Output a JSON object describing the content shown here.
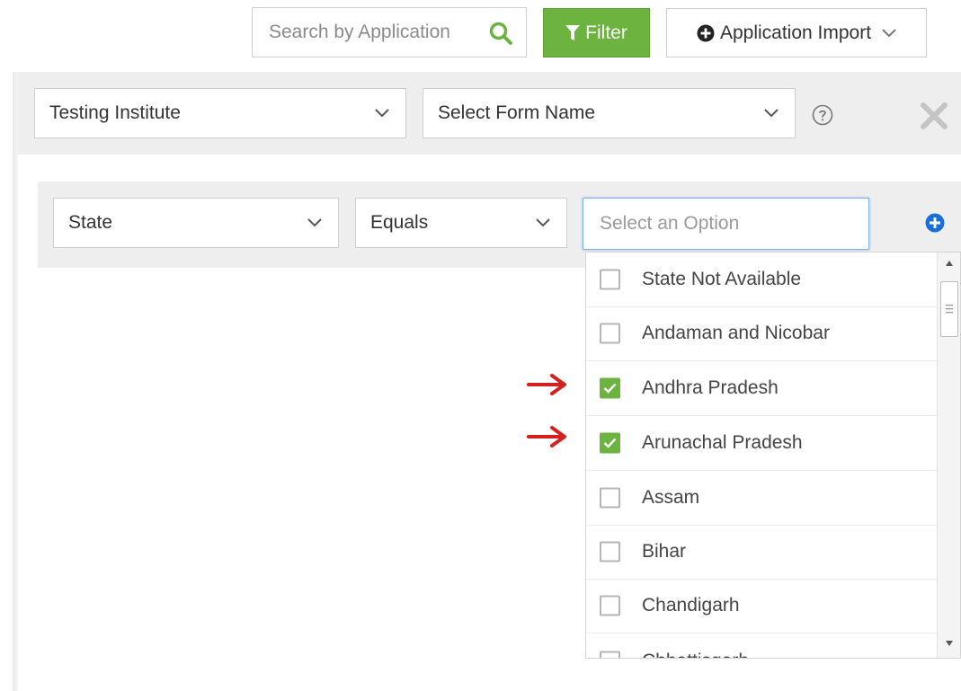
{
  "toolbar": {
    "search_placeholder": "Search by Application",
    "filter_label": "Filter",
    "import_label": "Application Import"
  },
  "form_filters": {
    "institute_value": "Testing Institute",
    "form_name_placeholder": "Select Form Name"
  },
  "condition": {
    "field_value": "State",
    "operator_value": "Equals",
    "option_placeholder": "Select an Option"
  },
  "options": [
    {
      "label": "State Not Available",
      "checked": false
    },
    {
      "label": "Andaman and Nicobar",
      "checked": false
    },
    {
      "label": "Andhra Pradesh",
      "checked": true
    },
    {
      "label": "Arunachal Pradesh",
      "checked": true
    },
    {
      "label": "Assam",
      "checked": false
    },
    {
      "label": "Bihar",
      "checked": false
    },
    {
      "label": "Chandigarh",
      "checked": false
    },
    {
      "label": "Chhattisgarh",
      "checked": false
    }
  ],
  "colors": {
    "accent_green": "#6db33f",
    "focus_blue": "#7fb0e6",
    "add_blue": "#1a6fd6",
    "annotation_red": "#d62020"
  },
  "icons": {
    "search": "magnifier-icon",
    "filter": "funnel-icon",
    "import": "plus-circle-icon",
    "help": "question-circle-icon",
    "close": "x-icon",
    "add": "plus-circle-icon"
  }
}
